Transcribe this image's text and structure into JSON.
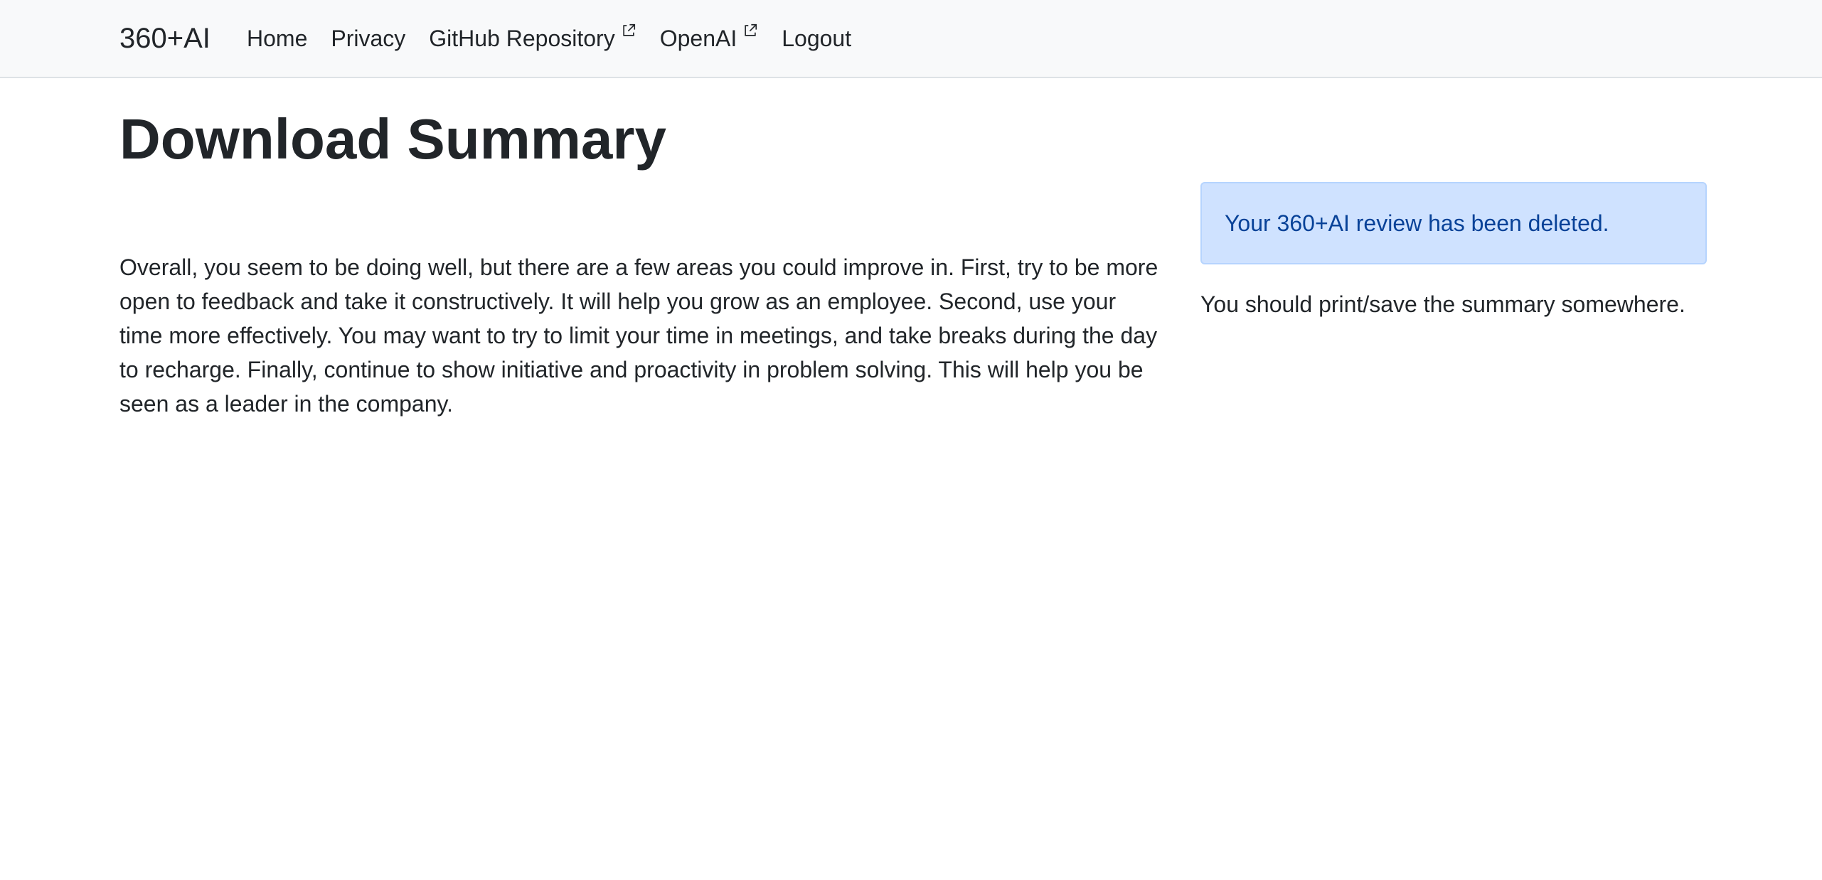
{
  "navbar": {
    "brand": "360+AI",
    "links": [
      {
        "label": "Home",
        "external": false
      },
      {
        "label": "Privacy",
        "external": false
      },
      {
        "label": "GitHub Repository",
        "external": true,
        "icon": "external-link-icon"
      },
      {
        "label": "OpenAI",
        "external": true,
        "icon": "external-link-icon"
      },
      {
        "label": "Logout",
        "external": false
      }
    ]
  },
  "page": {
    "title": "Download Summary",
    "summary": "Overall, you seem to be doing well, but there are a few areas you could improve in. First, try to be more open to feedback and take it constructively. It will help you grow as an employee. Second, use your time more effectively. You may want to try to limit your time in meetings, and take breaks during the day to recharge. Finally, continue to show initiative and proactivity in problem solving. This will help you be seen as a leader in the company."
  },
  "sidebar": {
    "alert": "Your 360+AI review has been deleted.",
    "advice": "You should print/save the summary somewhere."
  },
  "colors": {
    "navbar_bg": "#f8f9fa",
    "alert_bg": "#cfe2ff",
    "alert_border": "#b6d4fe",
    "alert_text": "#084298",
    "body_text": "#212529"
  }
}
